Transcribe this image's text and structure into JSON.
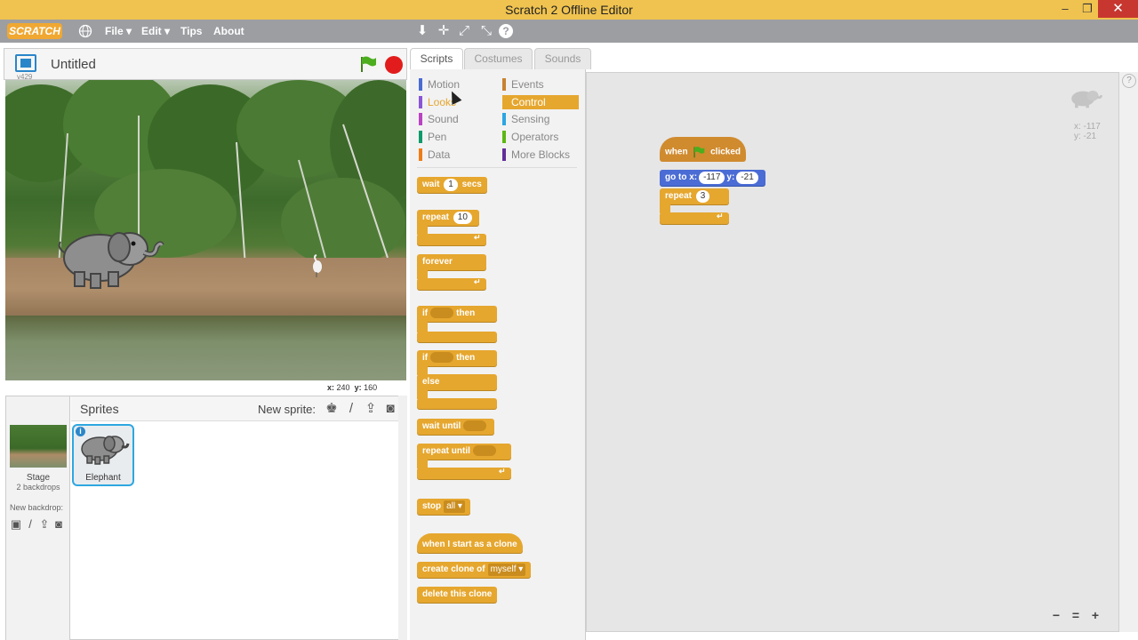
{
  "window": {
    "title": "Scratch 2 Offline Editor",
    "min_glyph": "–",
    "max_glyph": "❐",
    "close_glyph": "✕"
  },
  "menubar": {
    "logo_text": "SCRATCH",
    "file": "File ▾",
    "edit": "Edit ▾",
    "tips": "Tips",
    "about": "About",
    "icons": {
      "globe": "🌐",
      "duplicate": "⬇",
      "cut": "✛",
      "grow": "⤢",
      "shrink": "⤡",
      "help": "?"
    }
  },
  "stage": {
    "version": "v429",
    "project_title": "Untitled",
    "coords_x_label": "x:",
    "coords_x": "240",
    "coords_y_label": "y:",
    "coords_y": "160"
  },
  "sprites": {
    "title": "Sprites",
    "new_sprite_label": "New sprite:",
    "stage_label": "Stage",
    "backdrops": "2 backdrops",
    "new_backdrop_label": "New backdrop:",
    "items": [
      {
        "name": "Elephant"
      }
    ]
  },
  "tabs": [
    {
      "label": "Scripts",
      "active": true
    },
    {
      "label": "Costumes",
      "active": false
    },
    {
      "label": "Sounds",
      "active": false
    }
  ],
  "categories": [
    {
      "label": "Motion",
      "color": "#4a6cd4"
    },
    {
      "label": "Looks",
      "color": "#8a55d7"
    },
    {
      "label": "Sound",
      "color": "#bb42c3"
    },
    {
      "label": "Pen",
      "color": "#0e9a6c"
    },
    {
      "label": "Data",
      "color": "#ee7d16"
    },
    {
      "label": "Events",
      "color": "#c88330"
    },
    {
      "label": "Control",
      "color": "#e6a72f",
      "active": true
    },
    {
      "label": "Sensing",
      "color": "#2ca5e2"
    },
    {
      "label": "Operators",
      "color": "#5cb712"
    },
    {
      "label": "More Blocks",
      "color": "#632d99"
    }
  ],
  "palette_blocks": {
    "wait": {
      "pre": "wait",
      "val": "1",
      "post": "secs"
    },
    "repeat": {
      "pre": "repeat",
      "val": "10"
    },
    "forever": "forever",
    "if": {
      "pre": "if",
      "post": "then"
    },
    "ifelse": {
      "pre": "if",
      "post": "then",
      "else": "else"
    },
    "wait_until": "wait until",
    "repeat_until": "repeat until",
    "stop": {
      "pre": "stop",
      "option": "all"
    },
    "when_clone": "when I start as a clone",
    "create_clone": {
      "pre": "create clone of",
      "option": "myself"
    },
    "delete_clone": "delete this clone",
    "loop_arrow": "↵"
  },
  "script": {
    "hat": {
      "pre": "when",
      "post": "clicked"
    },
    "goto": {
      "pre": "go to x:",
      "x": "-117",
      "ylabel": "y:",
      "y": "-21"
    },
    "repeat": {
      "pre": "repeat",
      "val": "3"
    }
  },
  "script_area": {
    "sprite_x": "x: -117",
    "sprite_y": "y: -21",
    "zoom_out": "−",
    "zoom_reset": "=",
    "zoom_in": "+",
    "help": "?"
  }
}
